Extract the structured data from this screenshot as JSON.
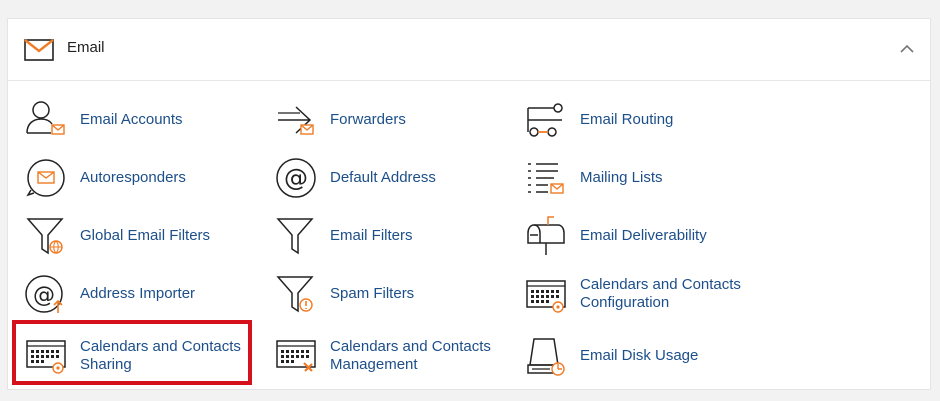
{
  "panel": {
    "title": "Email",
    "header_icon": "envelope-icon",
    "collapse_icon": "chevron-up-icon"
  },
  "items": [
    {
      "label": "Email Accounts",
      "icon": "email-accounts-icon"
    },
    {
      "label": "Forwarders",
      "icon": "forwarders-icon"
    },
    {
      "label": "Email Routing",
      "icon": "email-routing-icon"
    },
    {
      "label": "Autoresponders",
      "icon": "autoresponders-icon"
    },
    {
      "label": "Default Address",
      "icon": "default-address-icon"
    },
    {
      "label": "Mailing Lists",
      "icon": "mailing-lists-icon"
    },
    {
      "label": "Global Email Filters",
      "icon": "global-email-filters-icon"
    },
    {
      "label": "Email Filters",
      "icon": "email-filters-icon"
    },
    {
      "label": "Email Deliverability",
      "icon": "email-deliverability-icon"
    },
    {
      "label": "Address Importer",
      "icon": "address-importer-icon"
    },
    {
      "label": "Spam Filters",
      "icon": "spam-filters-icon"
    },
    {
      "label": "Calendars and Contacts Configuration",
      "icon": "calendars-contacts-configuration-icon"
    },
    {
      "label": "Calendars and Contacts Sharing",
      "icon": "calendars-contacts-sharing-icon"
    },
    {
      "label": "Calendars and Contacts Management",
      "icon": "calendars-contacts-management-icon"
    },
    {
      "label": "Email Disk Usage",
      "icon": "email-disk-usage-icon"
    }
  ],
  "colors": {
    "link": "#1c4f8a",
    "accent": "#f07c26",
    "highlight": "#d5121b"
  }
}
